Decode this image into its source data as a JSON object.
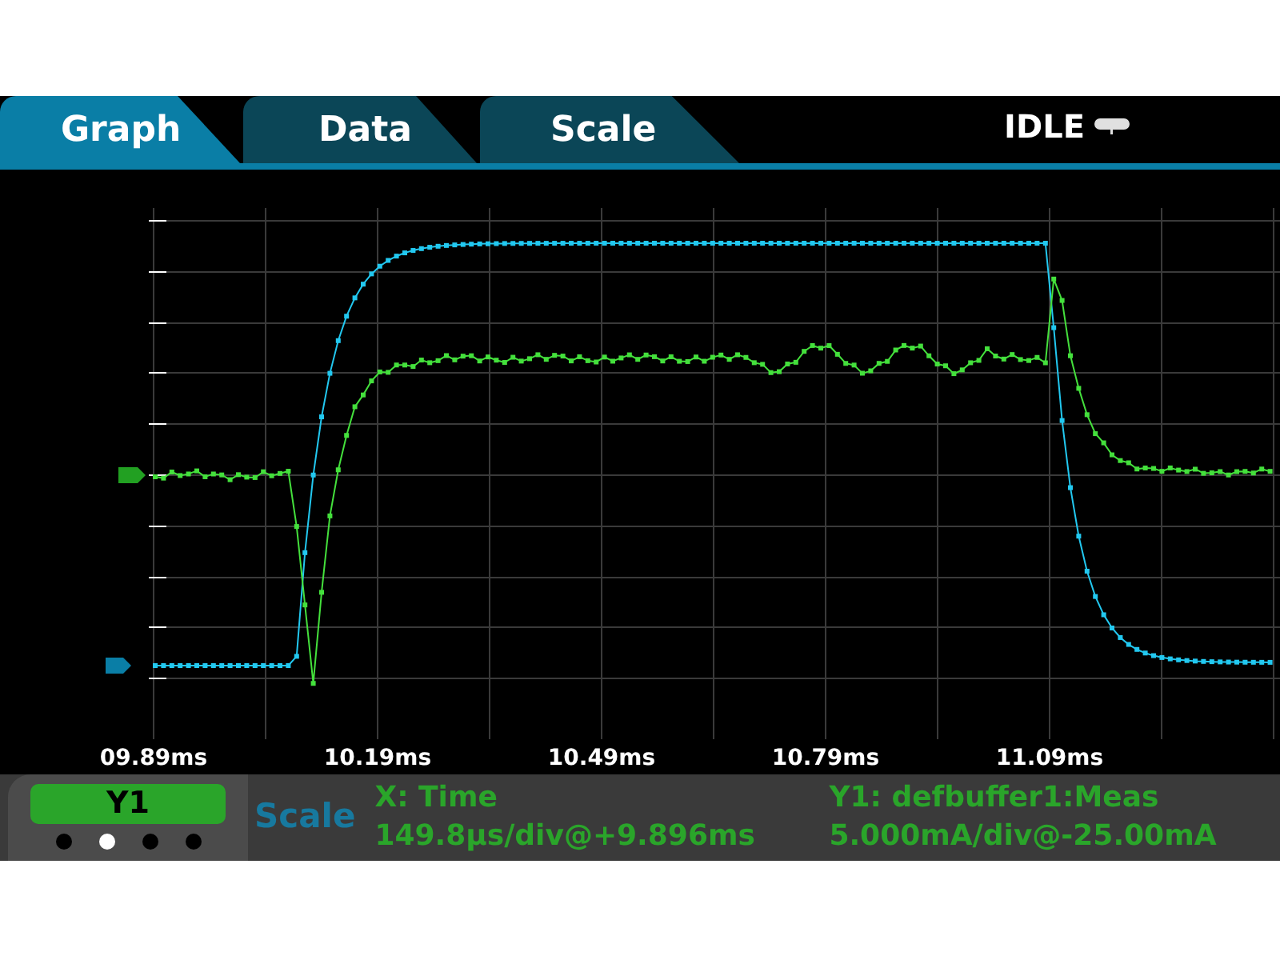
{
  "tabs": [
    {
      "label": "Graph",
      "selected": true
    },
    {
      "label": "Data",
      "selected": false
    },
    {
      "label": "Scale",
      "selected": false
    }
  ],
  "status": "IDLE",
  "x_axis_labels": [
    "09.89ms",
    "10.19ms",
    "10.49ms",
    "10.79ms",
    "11.09ms"
  ],
  "trace_selector": {
    "label": "Y1",
    "pages": [
      {
        "selected": false
      },
      {
        "selected": true
      },
      {
        "selected": false
      },
      {
        "selected": false
      }
    ]
  },
  "scale_label": "Scale",
  "x_info": {
    "title": "X: Time",
    "value": "149.8µs/div@+9.896ms"
  },
  "y_info": {
    "title": "Y1: defbuffer1:Meas",
    "value": "5.000mA/div@-25.00mA"
  }
}
